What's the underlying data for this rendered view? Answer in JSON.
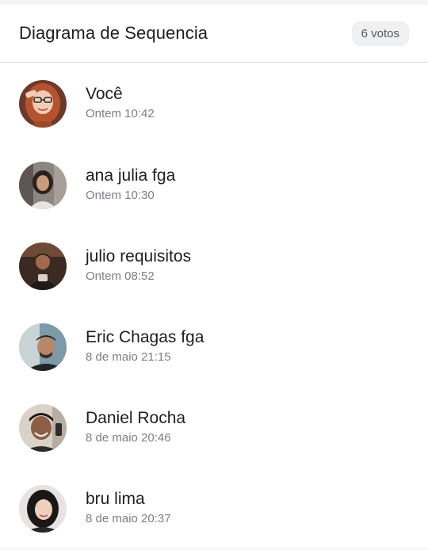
{
  "header": {
    "title": "Diagrama de Sequencia",
    "votes_badge": "6 votos"
  },
  "voters": [
    {
      "name": "Você",
      "time": "Ontem 10:42"
    },
    {
      "name": "ana julia fga",
      "time": "Ontem 10:30"
    },
    {
      "name": "julio requisitos",
      "time": "Ontem 08:52"
    },
    {
      "name": "Eric Chagas fga",
      "time": "8 de maio 21:15"
    },
    {
      "name": "Daniel Rocha",
      "time": "8 de maio 20:46"
    },
    {
      "name": "bru lima",
      "time": "8 de maio 20:37"
    }
  ],
  "colors": {
    "text_primary": "#1c1e21",
    "text_secondary": "#7a7f85",
    "badge_background": "#eef0f2",
    "divider": "#d7d9dc"
  }
}
